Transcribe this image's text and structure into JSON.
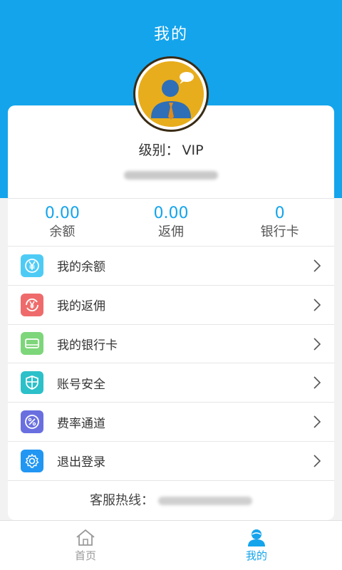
{
  "header": {
    "title": "我的"
  },
  "profile": {
    "level_label": "级别：",
    "level_value": "VIP"
  },
  "stats": [
    {
      "value": "0.00",
      "label": "余额"
    },
    {
      "value": "0.00",
      "label": "返佣"
    },
    {
      "value": "0",
      "label": "银行卡"
    }
  ],
  "menu": [
    {
      "label": "我的余额",
      "icon": "yen-icon",
      "color": "#4ecbf5"
    },
    {
      "label": "我的返佣",
      "icon": "yen-refund-icon",
      "color": "#ef6b6b"
    },
    {
      "label": "我的银行卡",
      "icon": "bank-card-icon",
      "color": "#7dd67a"
    },
    {
      "label": "账号安全",
      "icon": "shield-icon",
      "color": "#2cc0c9"
    },
    {
      "label": "费率通道",
      "icon": "percent-icon",
      "color": "#6a6fe0"
    },
    {
      "label": "退出登录",
      "icon": "gear-icon",
      "color": "#2196f3"
    }
  ],
  "hotline": {
    "label": "客服热线："
  },
  "tabbar": [
    {
      "label": "首页",
      "icon": "home-icon",
      "active": false
    },
    {
      "label": "我的",
      "icon": "user-icon",
      "active": true
    }
  ],
  "colors": {
    "primary": "#14a4ec",
    "background": "#f2f2f2"
  }
}
